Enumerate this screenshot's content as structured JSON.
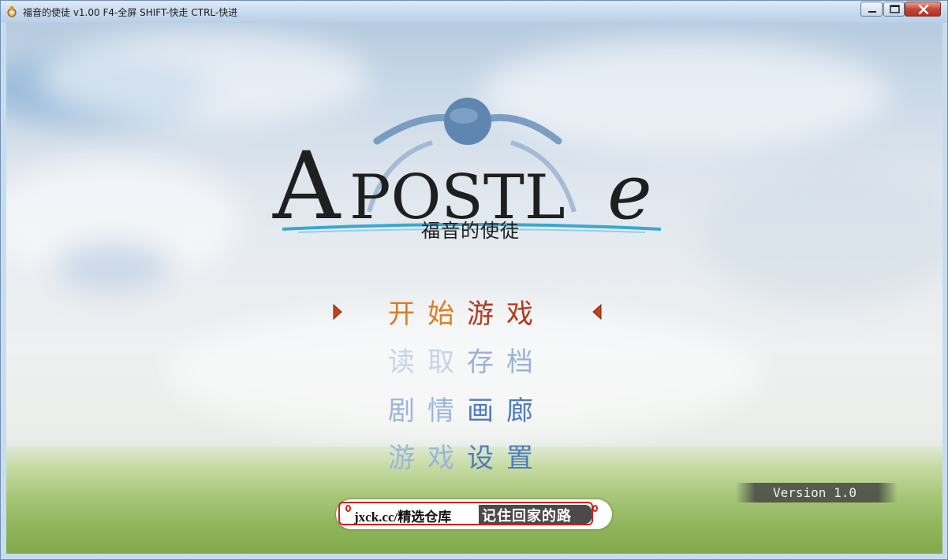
{
  "window": {
    "title": "福音的使徒 v1.00 F4-全屏 SHIFT-快走 CTRL-快进",
    "icon": "app-gear-icon",
    "controls": [
      "minimize-icon",
      "maximize-icon",
      "close-icon"
    ]
  },
  "logo": {
    "text": "APOSTLe",
    "subtitle": "福音的使徒"
  },
  "menu": {
    "start": {
      "c1": "开始",
      "c2": "游戏"
    },
    "load": {
      "c1": "读取",
      "c2": "存档"
    },
    "gallery": {
      "c1": "剧情",
      "c2": "画廊"
    },
    "settings": {
      "c1": "游戏",
      "c2": "设置"
    },
    "selected_index": 0
  },
  "version": "Version 1.0",
  "watermark": {
    "left": "jxck.cc/精选仓库",
    "right": "记住回家的路"
  },
  "colors": {
    "selected_primary": "#d97f24",
    "selected_secondary": "#b33a1e",
    "menu_blue": "#4f7bc0",
    "menu_light_blue": "#9bb5da",
    "arrow": "#c0451c",
    "watermark_border": "#d21e1e"
  }
}
